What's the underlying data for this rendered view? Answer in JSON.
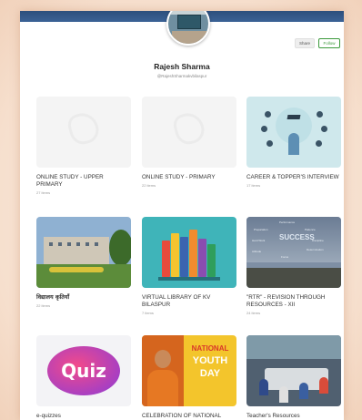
{
  "profile": {
    "name": "Rajesh Sharma",
    "handle": "@RajeshSharmakvbilaspur",
    "share_label": "Share",
    "follow_label": "Follow"
  },
  "collections": [
    {
      "title": "ONLINE STUDY - UPPER PRIMARY",
      "count": "27 items",
      "thumb": "placeholder"
    },
    {
      "title": "ONLINE STUDY - PRIMARY",
      "count": "22 items",
      "thumb": "placeholder"
    },
    {
      "title": "CAREER & TOPPER'S INTERVIEW",
      "count": "17 items",
      "thumb": "career-graduation-illustration"
    },
    {
      "title": "विद्यालय कृतियाँ",
      "count": "22 items",
      "thumb": "school-building-photo"
    },
    {
      "title": "VIRTUAL LIBRARY OF KV BILASPUR",
      "count": "7 items",
      "thumb": "books-shelf-illustration"
    },
    {
      "title": "\"RTR\" - REVISION THROUGH RESOURCES - XII",
      "count": "24 items",
      "thumb": "success-wordcloud-photo"
    },
    {
      "title": "e-quizzes",
      "count": "",
      "thumb": "quiz-graphic",
      "thumb_text": "Quiz"
    },
    {
      "title": "CELEBRATION OF NATIONAL",
      "count": "",
      "thumb": "national-youth-day-poster",
      "thumb_text": [
        "NATIONAL",
        "YOUTH",
        "DAY"
      ]
    },
    {
      "title": "Teacher's Resources",
      "count": "",
      "thumb": "classroom-photo"
    }
  ],
  "rtr_words": [
    "Performance",
    "Preparation",
    "Patience",
    "Hard Work",
    "Determination",
    "SUCCESS",
    "Discipline",
    "Attitude",
    "Focus"
  ],
  "colors": {
    "topbar": "#2d4f7c",
    "follow": "#3c9a3c",
    "background": "#f6dfcd"
  }
}
